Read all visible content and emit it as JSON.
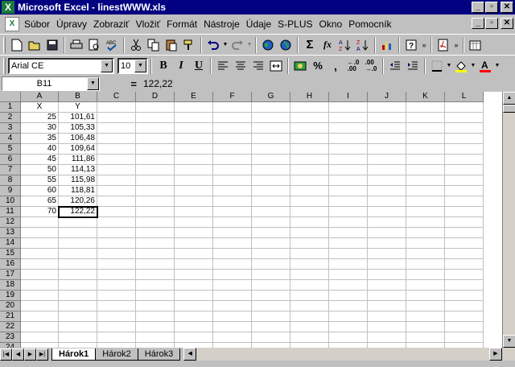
{
  "window": {
    "title": "Microsoft Excel - linestWWW.xls",
    "app_icon": "excel-icon",
    "buttons": [
      "minimize-icon",
      "maximize-icon",
      "close-icon"
    ],
    "button_glyphs": [
      "_",
      "▫",
      "✕"
    ]
  },
  "menu": {
    "items": [
      "Súbor",
      "Úpravy",
      "Zobraziť",
      "Vložiť",
      "Formát",
      "Nástroje",
      "Údaje",
      "S-PLUS",
      "Okno",
      "Pomocník"
    ]
  },
  "format_toolbar": {
    "font_name": "Arial CE",
    "font_size": "10",
    "bold": "B",
    "italic": "I",
    "underline": "U"
  },
  "formula_bar": {
    "name_box": "B11",
    "equals": "=",
    "content": "122,22"
  },
  "sheet": {
    "columns": [
      "A",
      "B",
      "C",
      "D",
      "E",
      "F",
      "G",
      "H",
      "I",
      "J",
      "K",
      "L"
    ],
    "rows": [
      "1",
      "2",
      "3",
      "4",
      "5",
      "6",
      "7",
      "8",
      "9",
      "10",
      "11",
      "12",
      "13",
      "14",
      "15",
      "16",
      "17",
      "18",
      "19",
      "20",
      "21",
      "22",
      "23",
      "24"
    ],
    "data": [
      [
        "X",
        "Y"
      ],
      [
        "25",
        "101,61"
      ],
      [
        "30",
        "105,33"
      ],
      [
        "35",
        "106,48"
      ],
      [
        "40",
        "109,64"
      ],
      [
        "45",
        "111,86"
      ],
      [
        "50",
        "114,13"
      ],
      [
        "55",
        "115,98"
      ],
      [
        "60",
        "118,81"
      ],
      [
        "65",
        "120,26"
      ],
      [
        "70",
        "122,22"
      ]
    ],
    "active_cell": "B11"
  },
  "tabs": {
    "items": [
      "Hárok1",
      "Hárok2",
      "Hárok3"
    ],
    "active": "Hárok1"
  }
}
